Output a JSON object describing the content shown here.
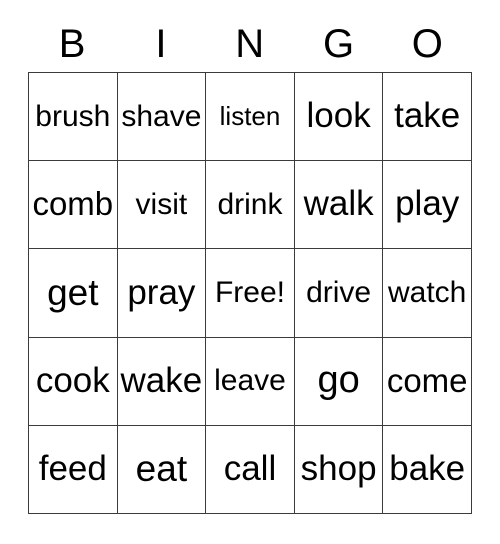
{
  "card": {
    "type": "bingo-card",
    "header_letters": [
      "B",
      "I",
      "N",
      "G",
      "O"
    ],
    "free_space_label": "Free!",
    "colors": {
      "background": "#ffffff",
      "text": "#000000",
      "grid_line": "#3b3b3b"
    },
    "rows": [
      [
        "brush",
        "shave",
        "listen",
        "look",
        "take"
      ],
      [
        "comb",
        "visit",
        "drink",
        "walk",
        "play"
      ],
      [
        "get",
        "pray",
        "Free!",
        "drive",
        "watch"
      ],
      [
        "cook",
        "wake",
        "leave",
        "go",
        "come"
      ],
      [
        "feed",
        "eat",
        "call",
        "shop",
        "bake"
      ]
    ]
  }
}
